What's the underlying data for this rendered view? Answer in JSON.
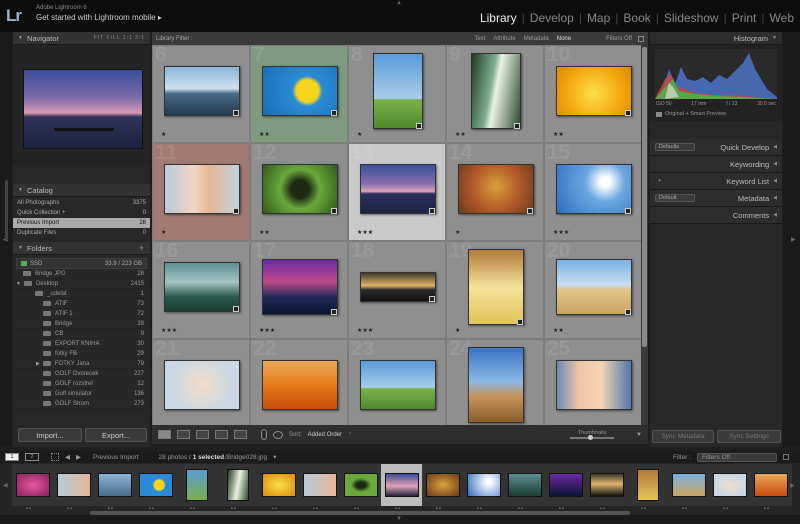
{
  "identity": {
    "logo": "Lr",
    "product": "Adobe Lightroom 6",
    "tagline": "Get started with Lightroom mobile",
    "arrow": "▸"
  },
  "modules": [
    "Library",
    "Develop",
    "Map",
    "Book",
    "Slideshow",
    "Print",
    "Web"
  ],
  "active_module": "Library",
  "left_panel": {
    "navigator": {
      "title": "Navigator",
      "zoom_opts": "FIT  FILL  1:1  3:1"
    },
    "catalog": {
      "title": "Catalog",
      "items": [
        {
          "label": "All Photographs",
          "count": "3375"
        },
        {
          "label": "Quick Collection +",
          "count": "0"
        },
        {
          "label": "Previous Import",
          "count": "28"
        },
        {
          "label": "Duplicate Files",
          "count": "0"
        }
      ]
    },
    "folders": {
      "title": "Folders",
      "add": "+",
      "volume": {
        "name": "SSD",
        "size": "33.9 / 223 GB"
      },
      "items": [
        {
          "label": "Bridge JPG",
          "count": "28"
        },
        {
          "label": "Desktop",
          "count": "2415"
        },
        {
          "label": "_udelat",
          "count": "1"
        },
        {
          "label": "ATIF",
          "count": "73"
        },
        {
          "label": "ATIF 1",
          "count": "72"
        },
        {
          "label": "Bridge",
          "count": "28"
        },
        {
          "label": "CB",
          "count": "9"
        },
        {
          "label": "EXPORT KNIHA",
          "count": "30"
        },
        {
          "label": "fotky FB",
          "count": "29"
        },
        {
          "label": "FOTKY Jana",
          "count": "79"
        },
        {
          "label": "GOLF Dvorecek",
          "count": "227"
        },
        {
          "label": "GOLF rozstrel",
          "count": "12"
        },
        {
          "label": "Golf simulator",
          "count": "136"
        },
        {
          "label": "GOLF Strom",
          "count": "273"
        }
      ]
    },
    "import_label": "Import...",
    "export_label": "Export..."
  },
  "filter_bar": {
    "label": "Library Filter :",
    "tabs": [
      "Text",
      "Attribute",
      "Metadata",
      "None"
    ],
    "active": "None",
    "status": "Filters Off"
  },
  "grid": {
    "cells": [
      {
        "num": "6",
        "stars": "★",
        "bg": "#8f8f8f"
      },
      {
        "num": "7",
        "stars": "★★",
        "bg": "#7f9a7e"
      },
      {
        "num": "8",
        "stars": "★",
        "bg": "#8f8f8f"
      },
      {
        "num": "9",
        "stars": "★★",
        "bg": "#8f8f8f"
      },
      {
        "num": "10",
        "stars": "★★",
        "bg": "#8f8f8f"
      },
      {
        "num": "11",
        "stars": "★",
        "bg": "#a17a72"
      },
      {
        "num": "12",
        "stars": "★★",
        "bg": "#8f8f8f"
      },
      {
        "num": "13",
        "stars": "★★★",
        "bg": "#c9c9c9"
      },
      {
        "num": "14",
        "stars": "★",
        "bg": "#8f8f8f"
      },
      {
        "num": "15",
        "stars": "★★★",
        "bg": "#8f8f8f"
      },
      {
        "num": "16",
        "stars": "★★★",
        "bg": "#8f8f8f"
      },
      {
        "num": "17",
        "stars": "★★★",
        "bg": "#8f8f8f"
      },
      {
        "num": "18",
        "stars": "★★★",
        "bg": "#8f8f8f"
      },
      {
        "num": "19",
        "stars": "★",
        "bg": "#8f8f8f"
      },
      {
        "num": "20",
        "stars": "★★",
        "bg": "#8f8f8f"
      },
      {
        "num": "21",
        "stars": "",
        "bg": "#8f8f8f"
      },
      {
        "num": "22",
        "stars": "",
        "bg": "#8f8f8f"
      },
      {
        "num": "23",
        "stars": "",
        "bg": "#8f8f8f"
      },
      {
        "num": "24",
        "stars": "",
        "bg": "#8f8f8f"
      },
      {
        "num": "25",
        "stars": "",
        "bg": "#8f8f8f"
      }
    ]
  },
  "right_panel": {
    "histogram": {
      "title": "Histogram",
      "iso": "ISO 50",
      "focal": "17 mm",
      "aperture": "f / 13",
      "shutter": "30.0 sec",
      "preview": "Original + Smart Preview"
    },
    "sections": [
      {
        "title": "Quick Develop",
        "dropdown": "Defaults"
      },
      {
        "title": "Keywording",
        "dropdown": ""
      },
      {
        "title": "Keyword List",
        "dropdown": "+"
      },
      {
        "title": "Metadata",
        "dropdown": "Default"
      },
      {
        "title": "Comments",
        "dropdown": ""
      }
    ],
    "sync_metadata": "Sync Metadata",
    "sync_settings": "Sync Settings"
  },
  "toolbar": {
    "sort_label": "Sort:",
    "sort_value": "Added Order",
    "thumbnails_label": "Thumbnails"
  },
  "filmstrip": {
    "pages": [
      "1",
      "2"
    ],
    "source": "Previous Import",
    "count_text": "28 photos /",
    "selected_text": "1 selected",
    "file": "/Bridge028.jpg",
    "filter_label": "Filter :",
    "filter_value": "Filters Off"
  },
  "colors": {
    "accent_active": "#eeeeee",
    "panel": "#282828",
    "grid": "#8a8a8a"
  }
}
